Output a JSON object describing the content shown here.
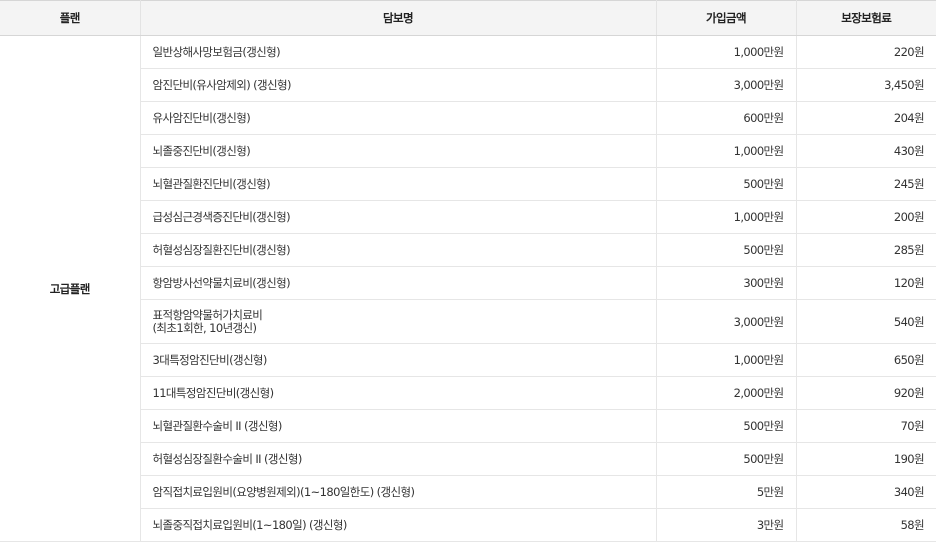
{
  "headers": {
    "plan": "플랜",
    "coverage": "담보명",
    "amount": "가입금액",
    "premium": "보장보험료"
  },
  "plan_name": "고급플랜",
  "rows": [
    {
      "name": "일반상해사망보험금(갱신형)",
      "amount": "1,000만원",
      "premium": "220원"
    },
    {
      "name": "암진단비(유사암제외) (갱신형)",
      "amount": "3,000만원",
      "premium": "3,450원"
    },
    {
      "name": "유사암진단비(갱신형)",
      "amount": "600만원",
      "premium": "204원"
    },
    {
      "name": "뇌졸중진단비(갱신형)",
      "amount": "1,000만원",
      "premium": "430원"
    },
    {
      "name": "뇌혈관질환진단비(갱신형)",
      "amount": "500만원",
      "premium": "245원"
    },
    {
      "name": "급성심근경색증진단비(갱신형)",
      "amount": "1,000만원",
      "premium": "200원"
    },
    {
      "name": "허혈성심장질환진단비(갱신형)",
      "amount": "500만원",
      "premium": "285원"
    },
    {
      "name": "항암방사선약물치료비(갱신형)",
      "amount": "300만원",
      "premium": "120원"
    },
    {
      "name_line1": "표적항암약물허가치료비",
      "name_line2": "(최초1회한, 10년갱신)",
      "amount": "3,000만원",
      "premium": "540원"
    },
    {
      "name": "3대특정암진단비(갱신형)",
      "amount": "1,000만원",
      "premium": "650원"
    },
    {
      "name": "11대특정암진단비(갱신형)",
      "amount": "2,000만원",
      "premium": "920원"
    },
    {
      "name": "뇌혈관질환수술비 II (갱신형)",
      "amount": "500만원",
      "premium": "70원"
    },
    {
      "name": "허혈성심장질환수술비 II (갱신형)",
      "amount": "500만원",
      "premium": "190원"
    },
    {
      "name": "암직접치료입원비(요양병원제외)(1~180일한도) (갱신형)",
      "amount": "5만원",
      "premium": "340원"
    },
    {
      "name": "뇌졸중직접치료입원비(1~180일) (갱신형)",
      "amount": "3만원",
      "premium": "58원"
    }
  ]
}
